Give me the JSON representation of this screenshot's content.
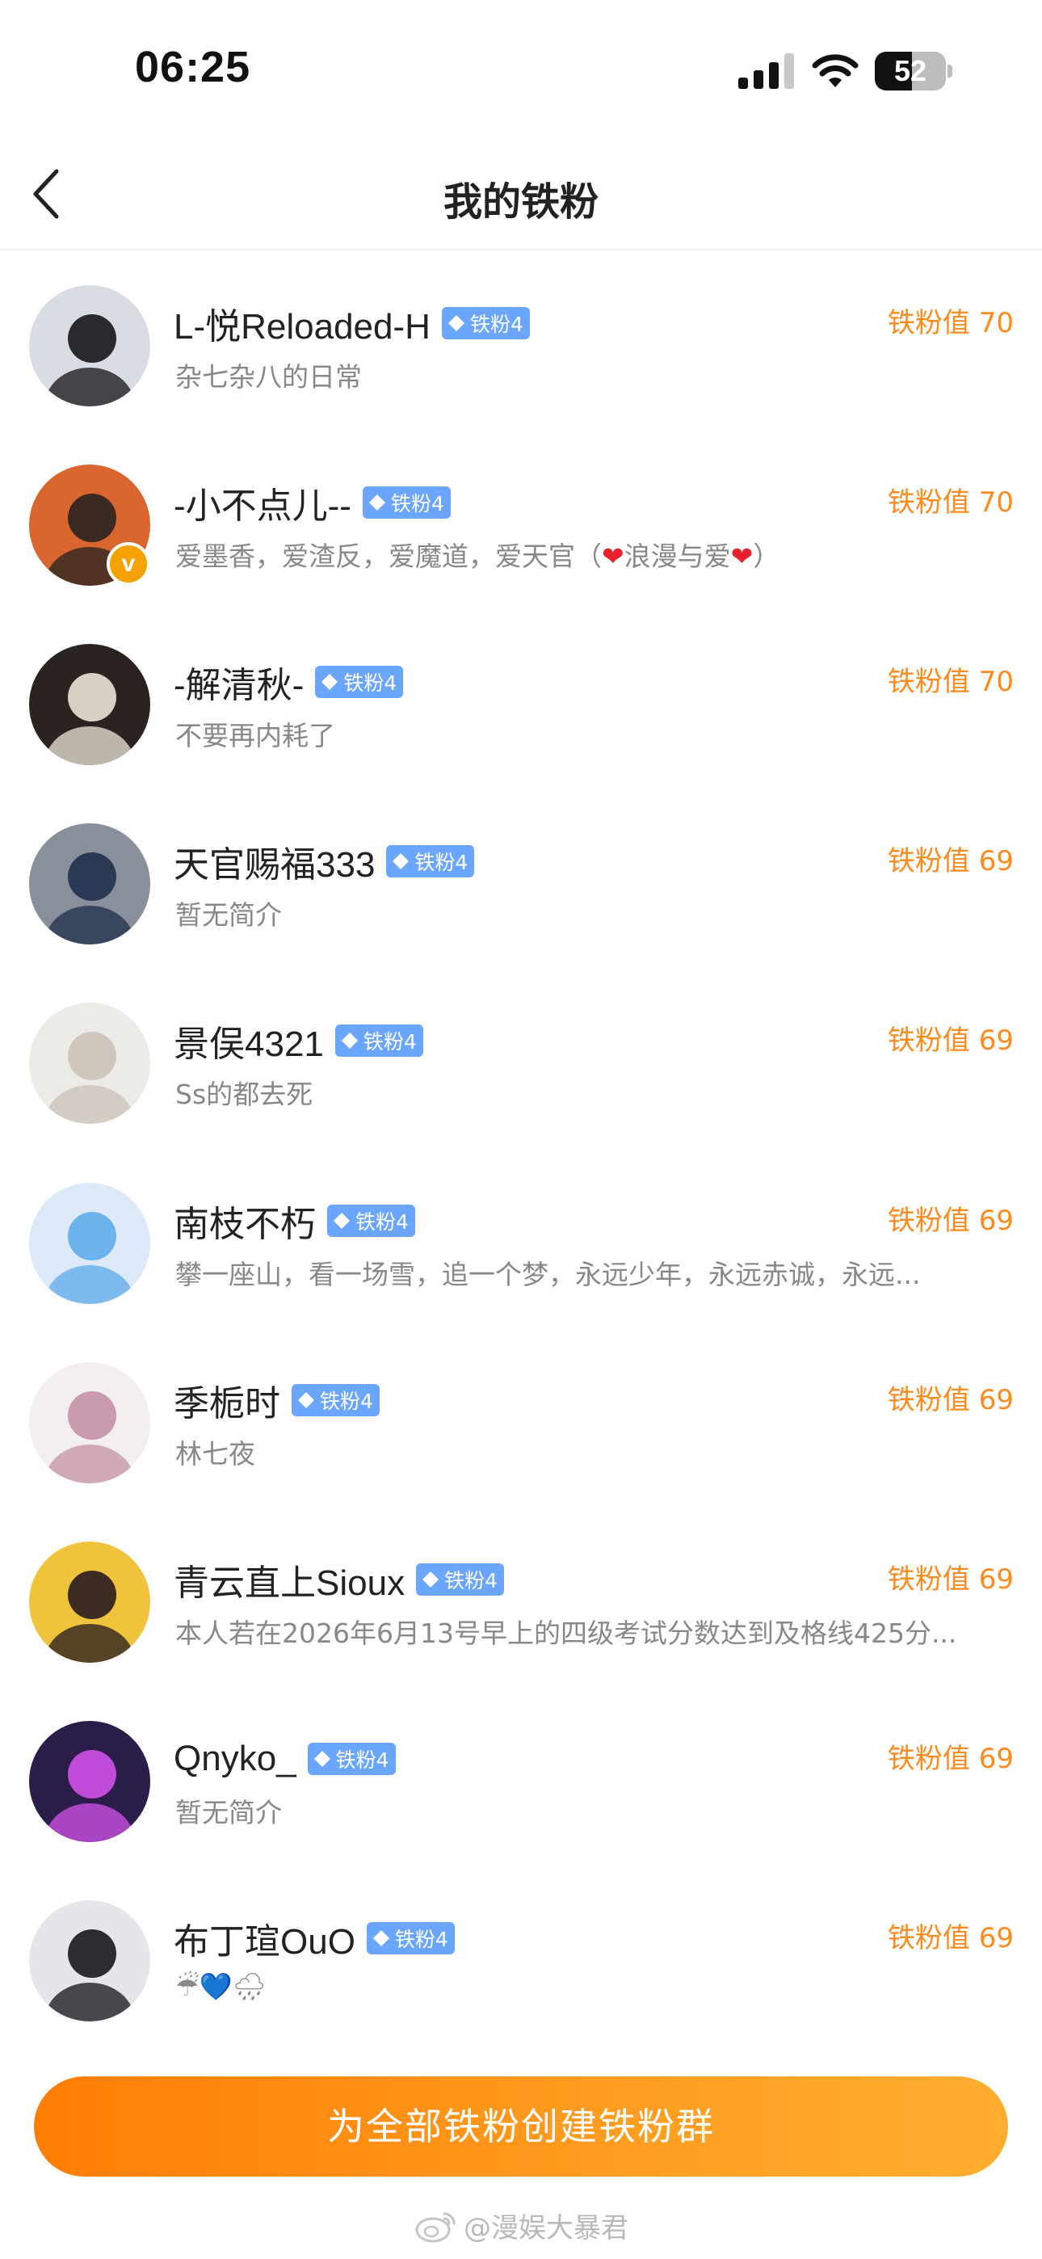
{
  "status_bar": {
    "time": "06:25",
    "battery_level": "52",
    "icons": [
      "signal-icon",
      "wifi-icon",
      "battery-icon"
    ]
  },
  "nav": {
    "title": "我的铁粉",
    "back_icon": "chevron-left-icon"
  },
  "fans": [
    {
      "name": "L-悦Reloaded-H",
      "badge": "铁粉4",
      "bio": "杂七杂八的日常",
      "score_label": "铁粉值 70",
      "verified": false
    },
    {
      "name": "-小不点儿--",
      "badge": "铁粉4",
      "bio_parts": [
        "爱墨香，爱渣反，爱魔道，爱天官（",
        "❤",
        "浪漫与爱",
        "❤",
        "）"
      ],
      "score_label": "铁粉值 70",
      "verified": true,
      "verified_glyph": "v"
    },
    {
      "name": "-解清秋-",
      "badge": "铁粉4",
      "bio": "不要再内耗了",
      "score_label": "铁粉值 70",
      "verified": false
    },
    {
      "name": "天官赐福333",
      "badge": "铁粉4",
      "bio": "暂无简介",
      "score_label": "铁粉值 69",
      "verified": false
    },
    {
      "name": "景俣4321",
      "badge": "铁粉4",
      "bio": "Ss的都去死",
      "score_label": "铁粉值 69",
      "verified": false
    },
    {
      "name": "南枝不朽",
      "badge": "铁粉4",
      "bio": "攀一座山，看一场雪，追一个梦，永远少年，永远赤诚，永远...",
      "score_label": "铁粉值 69",
      "verified": false
    },
    {
      "name": "季栀时",
      "badge": "铁粉4",
      "bio": "林七夜",
      "score_label": "铁粉值 69",
      "verified": false
    },
    {
      "name": "青云直上Sioux",
      "badge": "铁粉4",
      "bio": "本人若在2026年6月13号早上的四级考试分数达到及格线425分...",
      "score_label": "铁粉值 69",
      "verified": false
    },
    {
      "name": "Qnyko_",
      "badge": "铁粉4",
      "bio": "暂无简介",
      "score_label": "铁粉值 69",
      "verified": false
    },
    {
      "name": "布丁瑄OuO",
      "badge": "铁粉4",
      "bio": "☔💙🌧",
      "score_label": "铁粉值 69",
      "verified": false
    }
  ],
  "avatar_colors": [
    [
      "#d9dde3",
      "#2a2a2e"
    ],
    [
      "#d8662e",
      "#3a2a22"
    ],
    [
      "#2b2320",
      "#d7d0c4"
    ],
    [
      "#8a8f9c",
      "#2a3a55"
    ],
    [
      "#ecebe8",
      "#cfc7bd"
    ],
    [
      "#dde9f6",
      "#6cb2ec"
    ],
    [
      "#f3eef0",
      "#c89cae"
    ],
    [
      "#f0c33c",
      "#3b2b20"
    ],
    [
      "#2a1d4a",
      "#c04bd8"
    ],
    [
      "#e4e6ea",
      "#2c2c32"
    ]
  ],
  "bottom": {
    "button_label": "为全部铁粉创建铁粉群",
    "watermark": "@漫娱大暴君"
  },
  "colors": {
    "accent_orange": "#ff8a1e",
    "badge_blue": "#6aa6ff",
    "bio_gray": "#888888"
  }
}
